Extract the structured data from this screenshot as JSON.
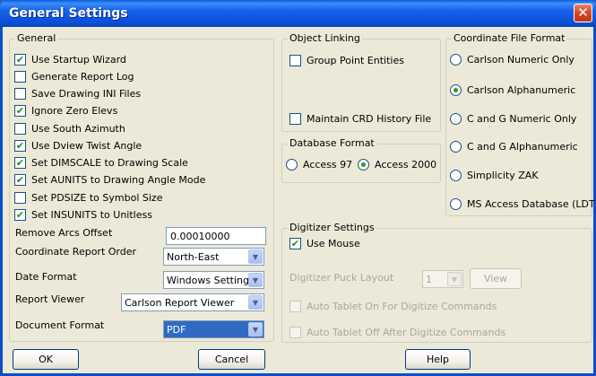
{
  "window": {
    "title": "General Settings",
    "close_symbol": "✕"
  },
  "general": {
    "title": "General",
    "options": [
      {
        "label": "Use Startup Wizard",
        "checked": true
      },
      {
        "label": "Generate Report Log",
        "checked": false
      },
      {
        "label": "Save Drawing INI Files",
        "checked": false
      },
      {
        "label": "Ignore Zero Elevs",
        "checked": true
      },
      {
        "label": "Use South Azimuth",
        "checked": false
      },
      {
        "label": "Use Dview Twist Angle",
        "checked": true
      },
      {
        "label": "Set DIMSCALE to Drawing Scale",
        "checked": true
      },
      {
        "label": "Set AUNITS to Drawing Angle Mode",
        "checked": true
      },
      {
        "label": "Set PDSIZE to Symbol Size",
        "checked": false
      },
      {
        "label": "Set INSUNITS to Unitless",
        "checked": true
      }
    ],
    "remove_arcs_offset_label": "Remove Arcs Offset",
    "remove_arcs_offset_value": "0.00010000",
    "coordinate_report_order_label": "Coordinate Report Order",
    "coordinate_report_order_value": "North-East",
    "date_format_label": "Date Format",
    "date_format_value": "Windows Setting",
    "report_viewer_label": "Report Viewer",
    "report_viewer_value": "Carlson Report Viewer",
    "document_format_label": "Document Format",
    "document_format_value": "PDF"
  },
  "object_linking": {
    "title": "Object Linking",
    "group_point_entities": {
      "label": "Group Point Entities",
      "checked": false
    },
    "maintain_crd_history": {
      "label": "Maintain CRD History File",
      "checked": false
    }
  },
  "database_format": {
    "title": "Database Format",
    "options": [
      {
        "label": "Access 97",
        "selected": false
      },
      {
        "label": "Access 2000",
        "selected": true
      }
    ]
  },
  "coordinate_file_format": {
    "title": "Coordinate File Format",
    "options": [
      {
        "label": "Carlson Numeric Only",
        "selected": false
      },
      {
        "label": "Carlson Alphanumeric",
        "selected": true
      },
      {
        "label": "C and G Numeric Only",
        "selected": false
      },
      {
        "label": "C and G Alphanumeric",
        "selected": false
      },
      {
        "label": "Simplicity ZAK",
        "selected": false
      },
      {
        "label": "MS Access Database (LDT)",
        "selected": false
      }
    ]
  },
  "digitizer": {
    "title": "Digitizer Settings",
    "use_mouse": {
      "label": "Use Mouse",
      "checked": true
    },
    "puck_layout_label": "Digitizer Puck Layout",
    "puck_layout_value": "1",
    "view_label": "View",
    "auto_on": {
      "label": "Auto Tablet On For Digitize Commands",
      "checked": false
    },
    "auto_off": {
      "label": "Auto Tablet Off After Digitize Commands",
      "checked": false
    }
  },
  "buttons": {
    "ok": "OK",
    "cancel": "Cancel",
    "help": "Help"
  },
  "colors": {
    "title_bar": "#0a4fd8",
    "dialog_bg": "#ece9d8",
    "check_green": "#21a121",
    "selection_blue": "#316ac5"
  }
}
